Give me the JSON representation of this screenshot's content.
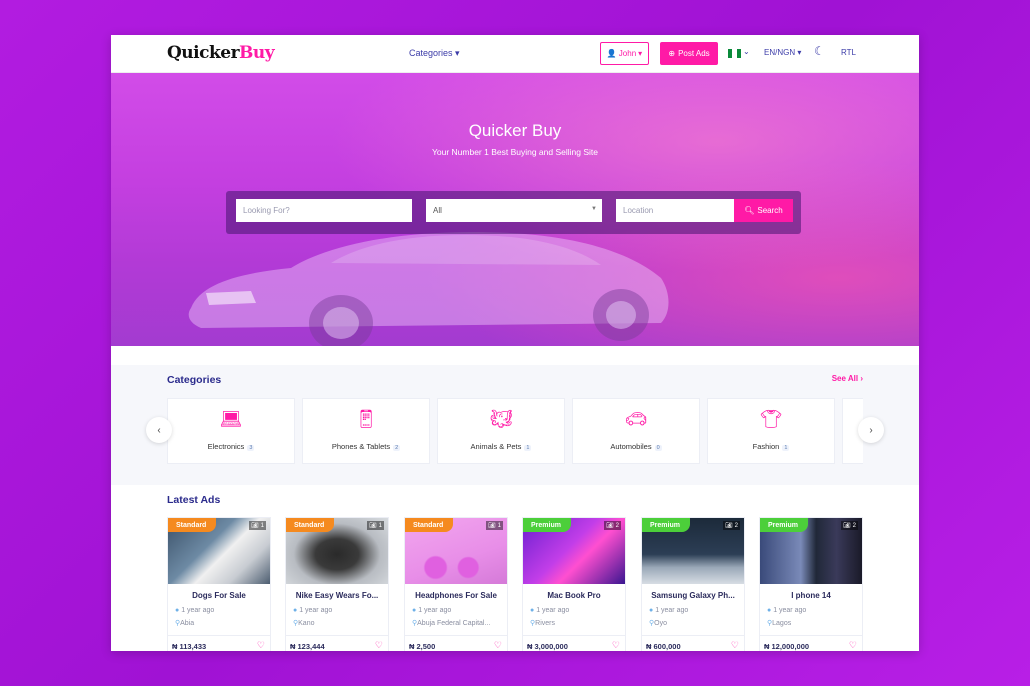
{
  "header": {
    "logo_part1": "Quicker",
    "logo_part2": "Buy",
    "categories_label": "Categories",
    "user_label": "John",
    "post_ads_label": "Post Ads",
    "lang_label": "EN/NGN",
    "rtl_label": "RTL"
  },
  "hero": {
    "title": "Quicker Buy",
    "subtitle": "Your Number 1 Best Buying and Selling Site",
    "search_placeholder": "Looking For?",
    "category_value": "All",
    "location_placeholder": "Location",
    "search_button": "Search"
  },
  "categories": {
    "title": "Categories",
    "see_all": "See All",
    "items": [
      {
        "label": "Electronics",
        "count": "3",
        "icon": "laptop-icon"
      },
      {
        "label": "Phones & Tablets",
        "count": "2",
        "icon": "phone-icon"
      },
      {
        "label": "Animals & Pets",
        "count": "1",
        "icon": "pet-icon"
      },
      {
        "label": "Automobiles",
        "count": "0",
        "icon": "car-icon"
      },
      {
        "label": "Fashion",
        "count": "1",
        "icon": "shirt-icon"
      }
    ]
  },
  "ads": {
    "title": "Latest Ads",
    "items": [
      {
        "badge": "Standard",
        "pics": "1",
        "title": "Dogs For Sale",
        "time": "1 year ago",
        "location": "Abia",
        "price": "₦ 113,433"
      },
      {
        "badge": "Standard",
        "pics": "1",
        "title": "Nike Easy Wears Fo...",
        "time": "1 year ago",
        "location": "Kano",
        "price": "₦ 123,444"
      },
      {
        "badge": "Standard",
        "pics": "1",
        "title": "Headphones For Sale",
        "time": "1 year ago",
        "location": "Abuja Federal Capital...",
        "price": "₦ 2,500"
      },
      {
        "badge": "Premium",
        "pics": "2",
        "title": "Mac Book Pro",
        "time": "1 year ago",
        "location": "Rivers",
        "price": "₦ 3,000,000"
      },
      {
        "badge": "Premium",
        "pics": "2",
        "title": "Samsung Galaxy Ph...",
        "time": "1 year ago",
        "location": "Oyo",
        "price": "₦ 600,000"
      },
      {
        "badge": "Premium",
        "pics": "2",
        "title": "I phone 14",
        "time": "1 year ago",
        "location": "Lagos",
        "price": "₦ 12,000,000"
      }
    ]
  },
  "colors": {
    "accent": "#ff1aa6",
    "standard_badge": "#f58a1f",
    "premium_badge": "#4ccf3a",
    "nav_text": "#3b3ba8"
  }
}
